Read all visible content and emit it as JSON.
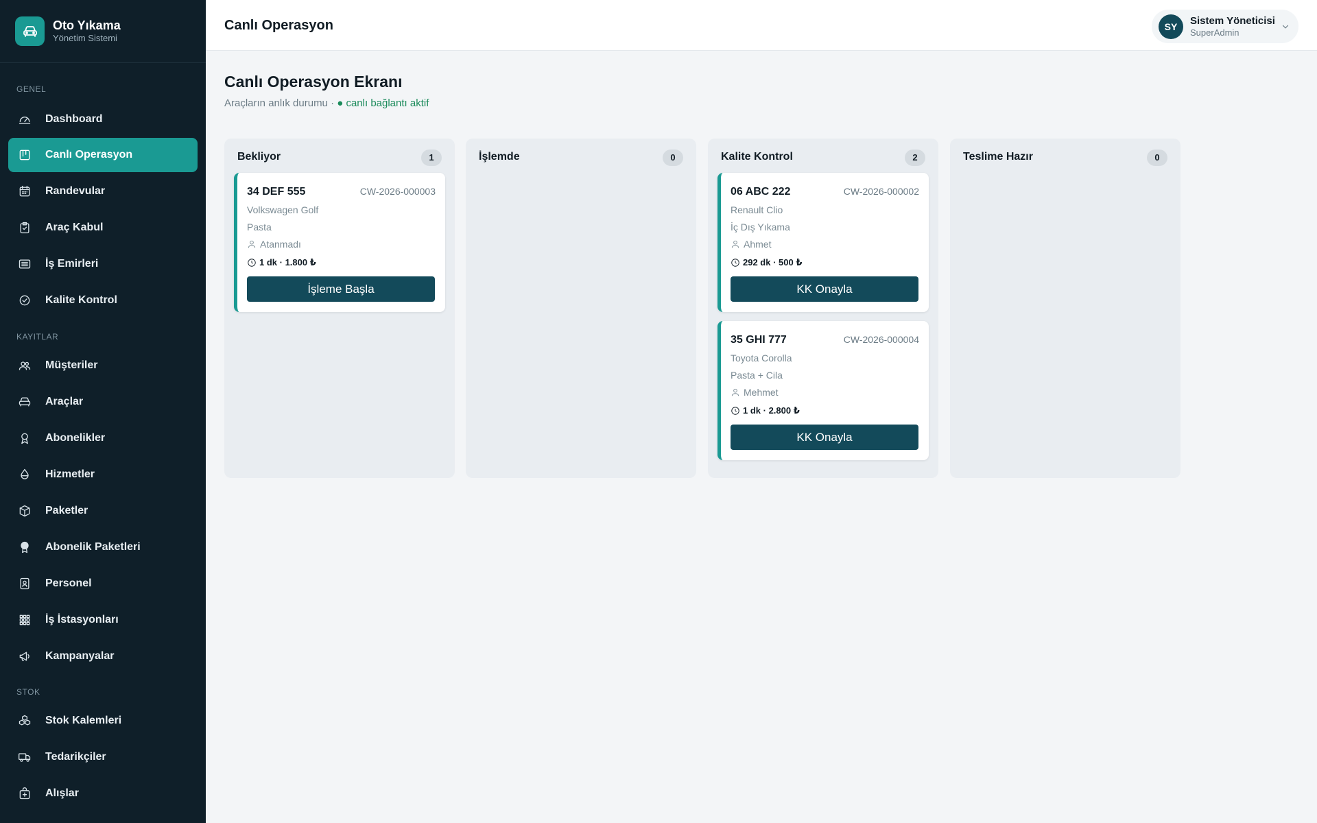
{
  "brand": {
    "title": "Oto Yıkama",
    "subtitle": "Yönetim Sistemi"
  },
  "sidebar": {
    "sections": [
      {
        "label": "GENEL",
        "items": [
          {
            "label": "Dashboard",
            "icon": "gauge-icon"
          },
          {
            "label": "Canlı Operasyon",
            "icon": "kanban-icon",
            "active": true
          },
          {
            "label": "Randevular",
            "icon": "calendar-icon"
          },
          {
            "label": "Araç Kabul",
            "icon": "clipboard-check-icon"
          },
          {
            "label": "İş Emirleri",
            "icon": "list-icon"
          },
          {
            "label": "Kalite Kontrol",
            "icon": "check-circle-icon"
          }
        ]
      },
      {
        "label": "KAYITLAR",
        "items": [
          {
            "label": "Müşteriler",
            "icon": "users-icon"
          },
          {
            "label": "Araçlar",
            "icon": "car-icon"
          },
          {
            "label": "Abonelikler",
            "icon": "award-icon"
          },
          {
            "label": "Hizmetler",
            "icon": "droplet-icon"
          },
          {
            "label": "Paketler",
            "icon": "package-icon"
          },
          {
            "label": "Abonelik Paketleri",
            "icon": "badge-icon"
          },
          {
            "label": "Personel",
            "icon": "id-badge-icon"
          },
          {
            "label": "İş İstasyonları",
            "icon": "grid-icon"
          },
          {
            "label": "Kampanyalar",
            "icon": "megaphone-icon"
          }
        ]
      },
      {
        "label": "STOK",
        "items": [
          {
            "label": "Stok Kalemleri",
            "icon": "boxes-icon"
          },
          {
            "label": "Tedarikçiler",
            "icon": "truck-icon"
          },
          {
            "label": "Alışlar",
            "icon": "bag-plus-icon"
          }
        ]
      }
    ]
  },
  "header": {
    "title": "Canlı Operasyon",
    "user": {
      "initials": "SY",
      "name": "Sistem Yöneticisi",
      "role": "SuperAdmin"
    }
  },
  "page": {
    "title": "Canlı Operasyon Ekranı",
    "subtitle": "Araçların anlık durumu · ",
    "live_status": "● canlı bağlantı aktif"
  },
  "columns": [
    {
      "title": "Bekliyor",
      "count": "1",
      "cards": [
        {
          "plate": "34 DEF 555",
          "code": "CW-2026-000003",
          "vehicle": "Volkswagen Golf",
          "service": "Pasta",
          "staff": "Atanmadı",
          "meta": "1 dk · 1.800 ₺",
          "action": "İşleme Başla"
        }
      ]
    },
    {
      "title": "İşlemde",
      "count": "0",
      "cards": []
    },
    {
      "title": "Kalite Kontrol",
      "count": "2",
      "cards": [
        {
          "plate": "06 ABC 222",
          "code": "CW-2026-000002",
          "vehicle": "Renault Clio",
          "service": "İç Dış Yıkama",
          "staff": "Ahmet",
          "meta": "292 dk · 500 ₺",
          "action": "KK Onayla"
        },
        {
          "plate": "35 GHI 777",
          "code": "CW-2026-000004",
          "vehicle": "Toyota Corolla",
          "service": "Pasta + Cila",
          "staff": "Mehmet",
          "meta": "1 dk · 2.800 ₺",
          "action": "KK Onayla"
        }
      ]
    },
    {
      "title": "Teslime Hazır",
      "count": "0",
      "cards": []
    }
  ],
  "colors": {
    "sidebar_bg": "#0f1f29",
    "accent": "#1a9a93",
    "button": "#134a5a",
    "live": "#1a8a5a"
  }
}
